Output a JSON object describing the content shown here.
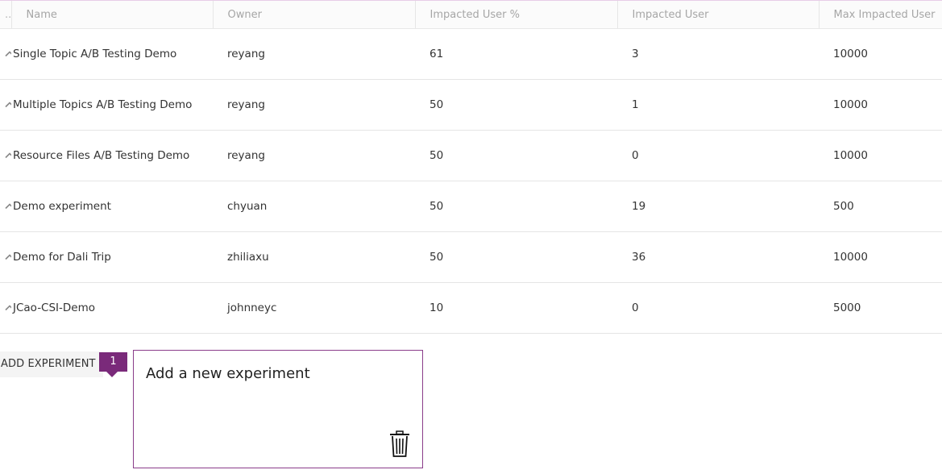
{
  "table": {
    "columns": {
      "expand": "..",
      "name": "Name",
      "owner": "Owner",
      "impacted_pct": "Impacted User %",
      "impacted": "Impacted User",
      "max_impacted": "Max Impacted User"
    },
    "rows": [
      {
        "name": "Single Topic A/B Testing Demo",
        "owner": "reyang",
        "impacted_pct": "61",
        "impacted": "3",
        "max_impacted": "10000"
      },
      {
        "name": "Multiple Topics A/B Testing Demo",
        "owner": "reyang",
        "impacted_pct": "50",
        "impacted": "1",
        "max_impacted": "10000"
      },
      {
        "name": "Resource Files A/B Testing Demo",
        "owner": "reyang",
        "impacted_pct": "50",
        "impacted": "0",
        "max_impacted": "10000"
      },
      {
        "name": "Demo experiment",
        "owner": "chyuan",
        "impacted_pct": "50",
        "impacted": "19",
        "max_impacted": "500"
      },
      {
        "name": "Demo for Dali Trip",
        "owner": "zhiliaxu",
        "impacted_pct": "50",
        "impacted": "36",
        "max_impacted": "10000"
      },
      {
        "name": "JCao-CSI-Demo",
        "owner": "johnneyc",
        "impacted_pct": "10",
        "impacted": "0",
        "max_impacted": "5000"
      }
    ]
  },
  "add_button": {
    "label": "ADD EXPERIMENT"
  },
  "badge": {
    "count": "1"
  },
  "callout": {
    "text": "Add a new experiment",
    "delete_icon": "trash-icon"
  },
  "icons": {
    "row_toggle": "chevron-up-icon"
  },
  "colors": {
    "accent": "#7a2a7a",
    "callout_border": "#8a3d8a",
    "header_text": "#a6a6a6"
  }
}
